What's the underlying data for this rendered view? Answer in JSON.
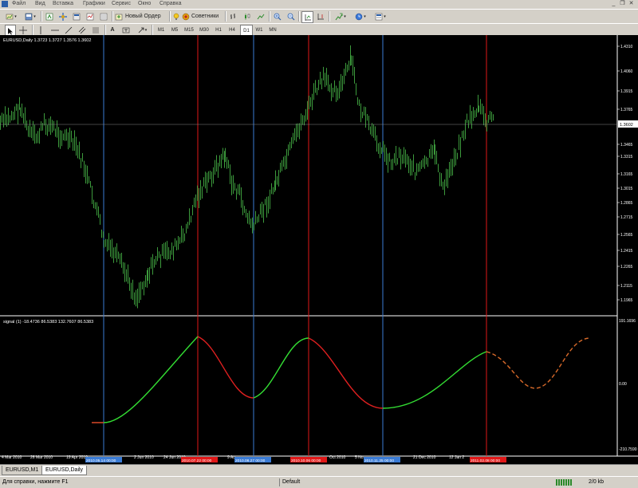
{
  "menu": {
    "items": [
      "Файл",
      "Вид",
      "Вставка",
      "Графики",
      "Сервис",
      "Окно",
      "Справка"
    ]
  },
  "toolbar1": {
    "new_order_label": "Новый Ордер",
    "experts_label": "Советники"
  },
  "toolbar2": {
    "timeframes": [
      "M1",
      "M5",
      "M15",
      "M30",
      "H1",
      "H4",
      "D1",
      "W1",
      "MN"
    ],
    "active_timeframe": "D1"
  },
  "main_chart": {
    "title": "EURUSD,Daily  1.3723  1.3727  1.3576  1.3602",
    "current_price_label": "1.3602",
    "price_ticks": [
      "1.4310",
      "1.4060",
      "1.3915",
      "1.3765",
      "1.3465",
      "1.3315",
      "1.3165",
      "1.3015",
      "1.2865",
      "1.2715",
      "1.2565",
      "1.2415",
      "1.2265",
      "1.2115",
      "1.1965"
    ]
  },
  "indicator": {
    "title": "signal (1)  -18.4736  86.5383  132.7607  86.5383",
    "axis_ticks": [
      "191.1696",
      "0.00",
      "-210.7590"
    ]
  },
  "time_axis": {
    "labels": [
      "4 Mar 2010",
      "26 Mar 2010",
      "19 Apr 2010",
      "2 Jun 2010",
      "24 Jun 2010",
      "9 Au",
      "Oct 2010",
      "5 No",
      "21 Dec 2010",
      "12 Jan 2"
    ],
    "highlights": [
      "2010.05.14 00:00",
      "2010.07.22 00:00",
      "2010.08.27 00:00",
      "2010.10.06 00:00",
      "2010.11.25 00:00",
      "2011.02.08 00:00"
    ]
  },
  "tabs": {
    "items": [
      "EURUSD,M1",
      "EURUSD,Daily"
    ],
    "active": "EURUSD,Daily"
  },
  "status": {
    "help": "Для справки, нажмите F1",
    "profile": "Default",
    "traffic": "2/0 kb"
  },
  "colors": {
    "background": "#000000",
    "candles": "#3c9a3c",
    "blue_line": "#3a7bd5",
    "red_line": "#e01818",
    "signal_up": "#33dd33",
    "signal_down": "#e02020",
    "forecast": "#d86a2a"
  }
}
